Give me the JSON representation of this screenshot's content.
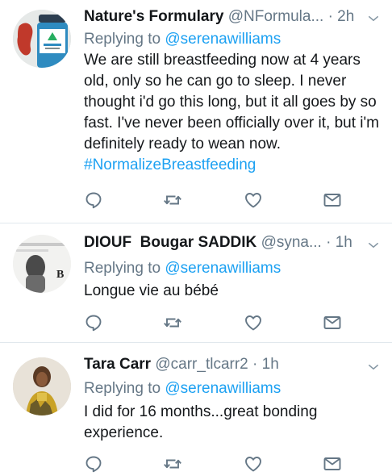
{
  "colors": {
    "link": "#1da1f2",
    "muted": "#657786",
    "divider": "#e1e8ed"
  },
  "tweets": [
    {
      "name": "Nature's Formulary",
      "handle": "@NFormula...",
      "time": "2h",
      "reply_prefix": "Replying to",
      "reply_to": "@serenawilliams",
      "text": "We are still breastfeeding now at 4 years old, only so he can go to sleep. I never thought i'd go this long, but it all goes by so fast. I've never been officially over it, but i'm definitely ready to wean now.",
      "hashtag": "#NormalizeBreastfeeding",
      "avatar_text": "",
      "icons": [
        "reply-icon",
        "retweet-icon",
        "like-icon",
        "message-icon"
      ]
    },
    {
      "name": "DIOUF  Bougar SADDIK",
      "handle": "@syna...",
      "time": "1h",
      "reply_prefix": "Replying to",
      "reply_to": "@serenawilliams",
      "text": "Longue vie au bébé",
      "avatar_text": "B",
      "icons": [
        "reply-icon",
        "retweet-icon",
        "like-icon",
        "message-icon"
      ]
    },
    {
      "name": "Tara Carr",
      "handle": "@carr_tlcarr2",
      "time": "1h",
      "reply_prefix": "Replying to",
      "reply_to": "@serenawilliams",
      "text": "I did for 16 months...great bonding experience.",
      "avatar_text": "",
      "icons": [
        "reply-icon",
        "retweet-icon",
        "like-icon",
        "message-icon"
      ]
    }
  ]
}
